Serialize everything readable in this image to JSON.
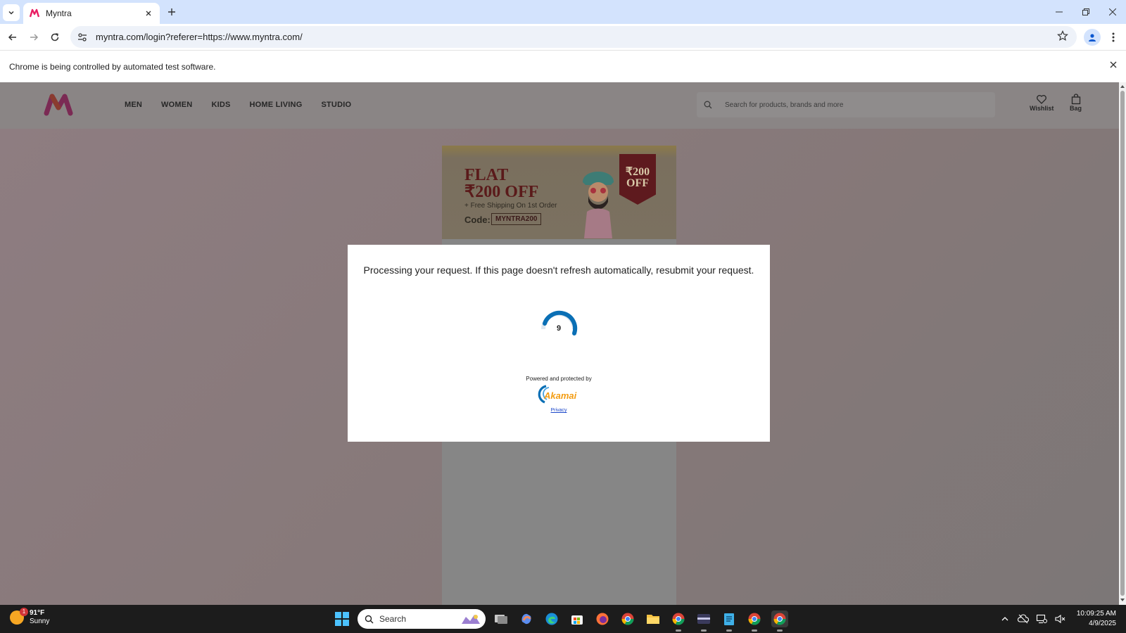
{
  "browser": {
    "tab_title": "Myntra",
    "url": "myntra.com/login?referer=https://www.myntra.com/",
    "infobar_text": "Chrome is being controlled by automated test software."
  },
  "site": {
    "nav": [
      "MEN",
      "WOMEN",
      "KIDS",
      "HOME LIVING",
      "STUDIO"
    ],
    "search_placeholder": "Search for products, brands and more",
    "wishlist_label": "Wishlist",
    "bag_label": "Bag",
    "banner": {
      "flat": "FLAT",
      "amount": "₹200 OFF",
      "shipping": "+ Free Shipping On 1st Order",
      "code_label": "Code:",
      "code": "MYNTRA200",
      "tag_line1": "₹200",
      "tag_line2": "OFF"
    }
  },
  "modal": {
    "message": "Processing your request. If this page doesn't refresh automatically, resubmit your request.",
    "counter": "9",
    "powered_by": "Powered and protected by",
    "brand": "Akamai",
    "privacy_link": "Privacy"
  },
  "taskbar": {
    "weather_temp": "91°F",
    "weather_desc": "Sunny",
    "weather_badge": "1",
    "search_label": "Search",
    "time": "10:09:25 AM",
    "date": "4/9/2025"
  },
  "colors": {
    "accent": "#0072bc",
    "akamai_orange": "#f39c12",
    "overlay": "#857878"
  }
}
